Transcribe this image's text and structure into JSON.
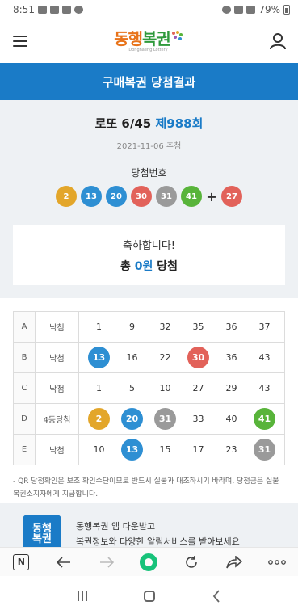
{
  "status_bar": {
    "time": "8:51",
    "battery": "79%"
  },
  "app": {
    "logo_text_a": "동행",
    "logo_text_b": "복권",
    "logo_sub": "Donghaeng Lottery"
  },
  "header": {
    "title": "구매복권 당첨결과"
  },
  "result": {
    "game_name": "로또 6/45",
    "round": "제988회",
    "draw_date": "2021-11-06 추첨",
    "win_numbers_label": "당첨번호",
    "win_numbers": [
      {
        "value": "2",
        "color": "#e3a62a"
      },
      {
        "value": "13",
        "color": "#2e8fd3"
      },
      {
        "value": "20",
        "color": "#2e8fd3"
      },
      {
        "value": "30",
        "color": "#e2625a"
      },
      {
        "value": "31",
        "color": "#9a9a9a"
      },
      {
        "value": "41",
        "color": "#58b43a"
      }
    ],
    "plus": "+",
    "bonus_number": {
      "value": "27",
      "color": "#e2625a"
    },
    "congrats": "축하합니다!",
    "total_prefix": "총",
    "total_amount": "0원",
    "total_suffix": "당첨"
  },
  "games": [
    {
      "slot": "A",
      "status": "낙첨",
      "numbers": [
        "1",
        "9",
        "32",
        "35",
        "36",
        "37"
      ],
      "hits": [
        null,
        null,
        null,
        null,
        null,
        null
      ]
    },
    {
      "slot": "B",
      "status": "낙첨",
      "numbers": [
        "13",
        "16",
        "22",
        "30",
        "36",
        "43"
      ],
      "hits": [
        "#2e8fd3",
        null,
        null,
        "#e2625a",
        null,
        null
      ]
    },
    {
      "slot": "C",
      "status": "낙첨",
      "numbers": [
        "1",
        "5",
        "10",
        "27",
        "29",
        "43"
      ],
      "hits": [
        null,
        null,
        null,
        null,
        null,
        null
      ]
    },
    {
      "slot": "D",
      "status": "4등당첨",
      "numbers": [
        "2",
        "20",
        "31",
        "33",
        "40",
        "41"
      ],
      "hits": [
        "#e3a62a",
        "#2e8fd3",
        "#9a9a9a",
        null,
        null,
        "#58b43a"
      ]
    },
    {
      "slot": "E",
      "status": "낙첨",
      "numbers": [
        "10",
        "13",
        "15",
        "17",
        "23",
        "31"
      ],
      "hits": [
        null,
        "#2e8fd3",
        null,
        null,
        null,
        "#9a9a9a"
      ]
    }
  ],
  "note": "- QR 당첨확인은 보조 확인수단이므로 반드시 실물과 대조하시기 바라며, 당첨금은 실물 복권소지자에게 지급합니다.",
  "promo": {
    "icon_line1": "동행",
    "icon_line2": "복권",
    "line1": "동행복권 앱 다운받고",
    "line2": "복권정보와 다양한 알림서비스를 받아보세요"
  },
  "browser_toolbar": {
    "tabs_label": "N",
    "icons": [
      "tabs-icon",
      "back-icon",
      "forward-icon",
      "home-ring-icon",
      "reload-icon",
      "share-icon",
      "more-icon"
    ]
  },
  "system_nav": {
    "icons": [
      "recents-icon",
      "home-icon",
      "back-icon"
    ]
  }
}
